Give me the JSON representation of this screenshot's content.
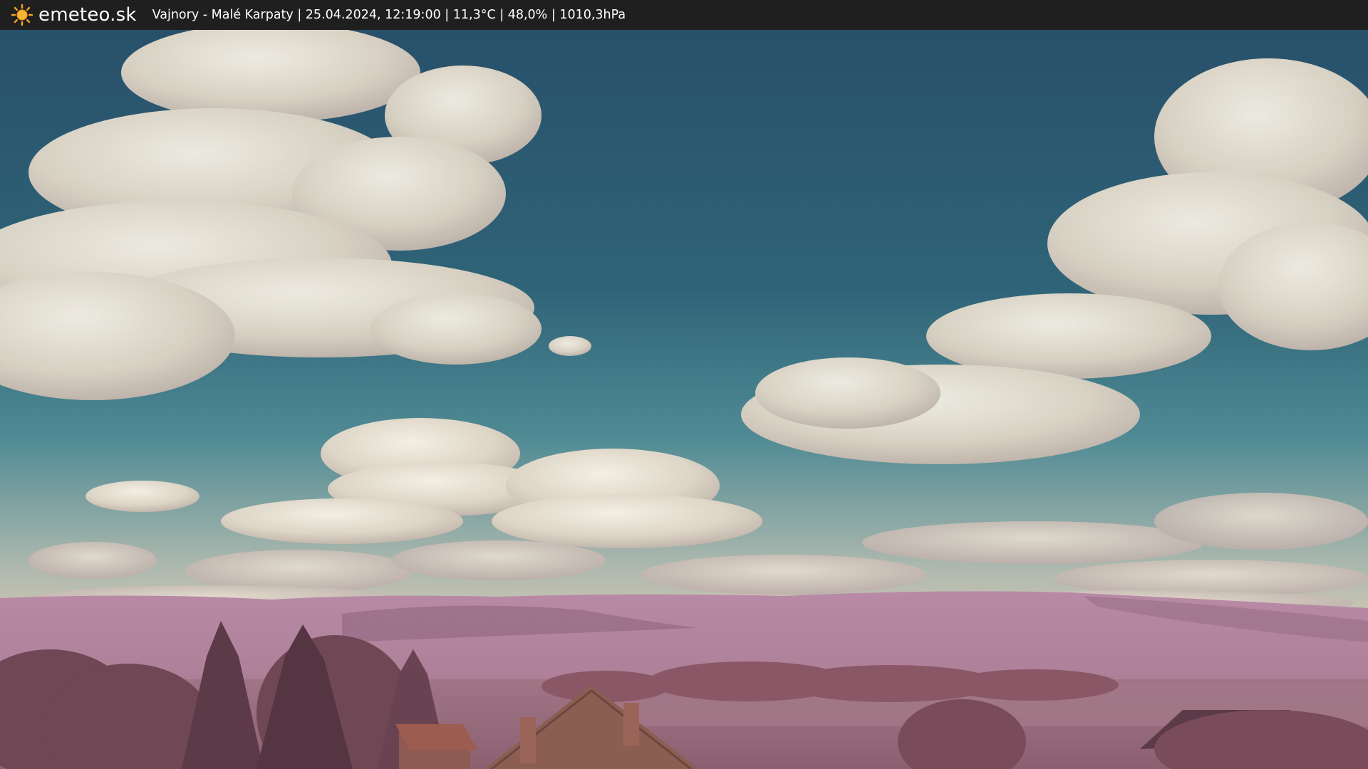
{
  "header": {
    "logo_icon": "sun-icon",
    "site_name": "emeteo.sk",
    "caption": "Vajnory - Malé Karpaty | 25.04.2024, 12:19:00 | 11,3°C | 48,0% | 1010,3hPa"
  },
  "colors": {
    "topbar": "#1f1f1f",
    "sun": "#f5a623",
    "sky_top": "#2e5570",
    "sky_mid": "#3c7a8e",
    "hills": "#b88aa6",
    "trees": "#8a5464"
  }
}
